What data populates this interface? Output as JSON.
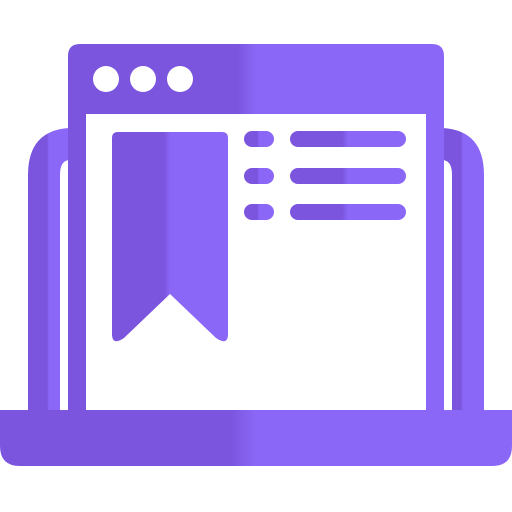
{
  "icon": {
    "name": "laptop-bookmark-icon",
    "parts": [
      "laptop-base-icon",
      "browser-window-icon",
      "bookmark-icon",
      "list-lines-icon"
    ]
  },
  "colors": {
    "gradient_start": "#7B55DE",
    "gradient_end": "#8B67F7",
    "background": "#FFFFFF"
  },
  "list": {
    "rows": 3,
    "window_dots": 3
  }
}
